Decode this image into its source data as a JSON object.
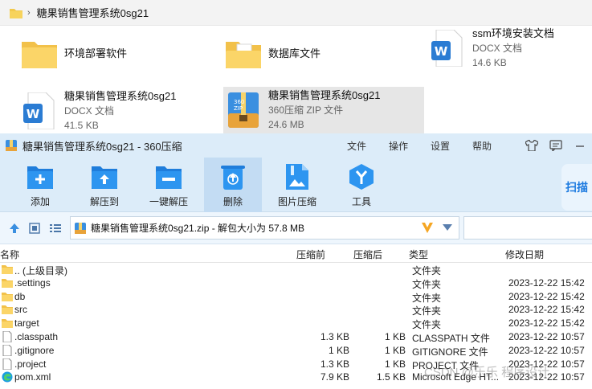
{
  "explorer": {
    "breadcrumb": "糖果销售管理系统0sg21",
    "breadcrumb_sep": "›",
    "items": [
      {
        "name": "环境部署软件",
        "type": "",
        "size": "",
        "icon": "folder-icon"
      },
      {
        "name": "数据库文件",
        "type": "",
        "size": "",
        "icon": "folder-doc-icon"
      },
      {
        "name": "ssm环境安装文档",
        "type": "DOCX 文档",
        "size": "14.6 KB",
        "icon": "word-icon"
      },
      {
        "name": "糖果销售管理系统0sg21",
        "type": "DOCX 文档",
        "size": "41.5 KB",
        "icon": "word-icon"
      },
      {
        "name": "糖果销售管理系统0sg21",
        "type": "360压缩 ZIP 文件",
        "size": "24.6 MB",
        "icon": "zip-icon"
      }
    ]
  },
  "window": {
    "title": "糖果销售管理系统0sg21 - 360压缩",
    "menu": [
      "文件",
      "操作",
      "设置",
      "帮助"
    ],
    "toolbar": [
      "添加",
      "解压到",
      "一键解压",
      "删除",
      "图片压缩",
      "工具"
    ],
    "scan_label": "扫描",
    "address": "糖果销售管理系统0sg21.zip - 解包大小为 57.8 MB",
    "columns": {
      "name": "名称",
      "csize": "压缩前",
      "usize": "压缩后",
      "type": "类型",
      "date": "修改日期"
    },
    "rows": [
      {
        "name": ".. (上级目录)",
        "csize": "",
        "usize": "",
        "type": "文件夹",
        "date": "",
        "icon": "folder-icon"
      },
      {
        "name": ".settings",
        "csize": "",
        "usize": "",
        "type": "文件夹",
        "date": "2023-12-22 15:42",
        "icon": "folder-icon"
      },
      {
        "name": "db",
        "csize": "",
        "usize": "",
        "type": "文件夹",
        "date": "2023-12-22 15:42",
        "icon": "folder-icon"
      },
      {
        "name": "src",
        "csize": "",
        "usize": "",
        "type": "文件夹",
        "date": "2023-12-22 15:42",
        "icon": "folder-icon"
      },
      {
        "name": "target",
        "csize": "",
        "usize": "",
        "type": "文件夹",
        "date": "2023-12-22 15:42",
        "icon": "folder-icon"
      },
      {
        "name": ".classpath",
        "csize": "1.3 KB",
        "usize": "1 KB",
        "type": "CLASSPATH 文件",
        "date": "2023-12-22 10:57",
        "icon": "file-icon"
      },
      {
        "name": ".gitignore",
        "csize": "1 KB",
        "usize": "1 KB",
        "type": "GITIGNORE 文件",
        "date": "2023-12-22 10:57",
        "icon": "file-icon"
      },
      {
        "name": ".project",
        "csize": "1.3 KB",
        "usize": "1 KB",
        "type": "PROJECT 文件",
        "date": "2023-12-22 10:57",
        "icon": "file-icon"
      },
      {
        "name": "pom.xml",
        "csize": "7.9 KB",
        "usize": "1.5 KB",
        "type": "Microsoft Edge HT...",
        "date": "2023-12-22 10:57",
        "icon": "edge-icon"
      }
    ]
  },
  "watermark": "CSDN @乐乐 程序设计"
}
